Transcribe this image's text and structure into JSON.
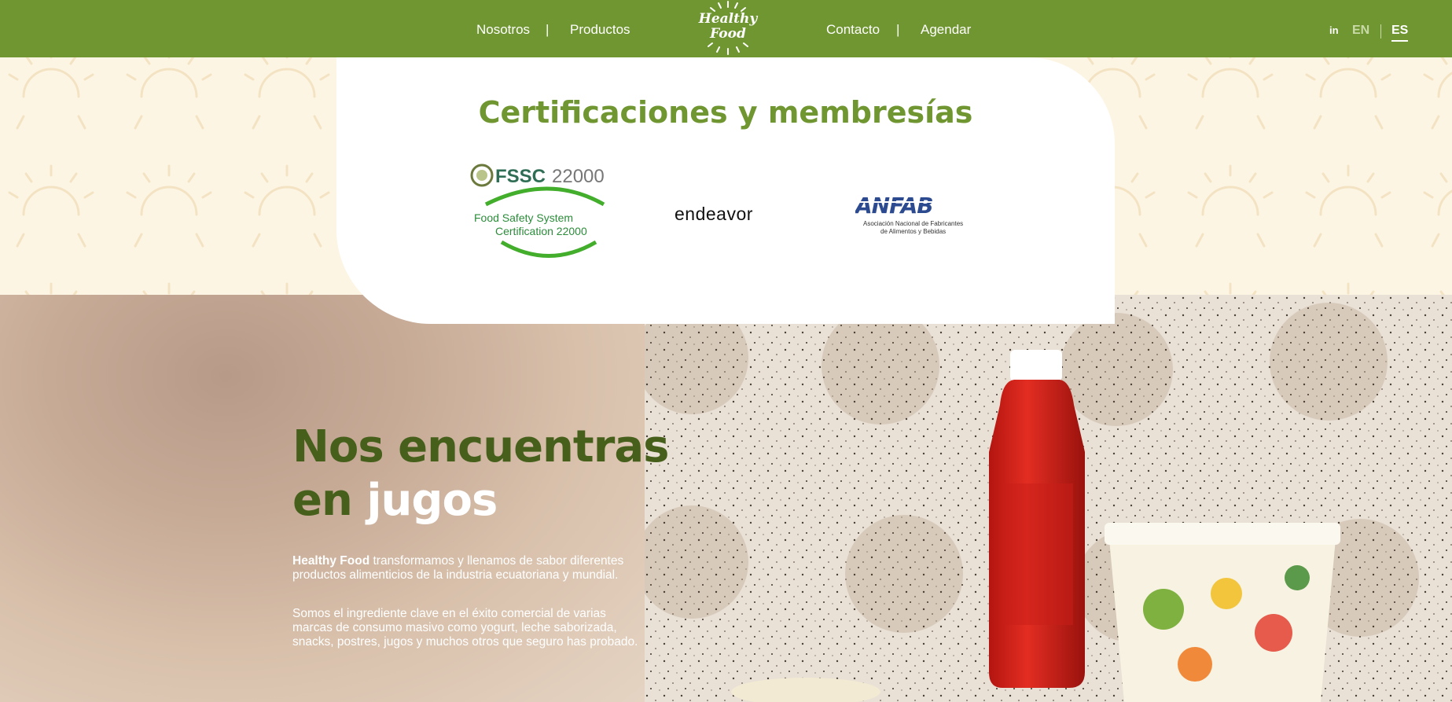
{
  "nav": {
    "items": [
      "Nosotros",
      "Productos",
      "Contacto",
      "Agendar"
    ],
    "separator": "|",
    "logo_line1": "Healthy",
    "logo_line2": "Food",
    "social": "in",
    "languages": [
      "EN",
      "ES"
    ],
    "active_language": "ES"
  },
  "certs": {
    "title": "Certificaciones y membresías",
    "fssc_title": "FSSC 22000",
    "fssc_line1": "Food Safety  System",
    "fssc_line2": "Certification 22000",
    "endeavor": "endeavor",
    "anfab": "ANFAB",
    "anfab_line1": "Asociación Nacional de Fabricantes",
    "anfab_line2": "de Alimentos y Bebidas"
  },
  "hero": {
    "headline_line1": "Nos encuentras",
    "headline_line2_a": "en ",
    "headline_line2_b": "jugos",
    "para1_brand": "Healthy Food",
    "para1_rest": " transformamos y llenamos de sabor diferentes productos alimenticios de la industria ecuatoriana y mundial.",
    "para2": "Somos el ingrediente clave en el éxito comercial de varias marcas de consumo masivo como yogurt, leche saborizada, snacks, postres, jugos y muchos otros que seguro has probado."
  },
  "colors": {
    "nav_green": "#6f9630",
    "title_green": "#6f9630",
    "headline_green": "#46601c",
    "cream": "#fdf5e4"
  }
}
